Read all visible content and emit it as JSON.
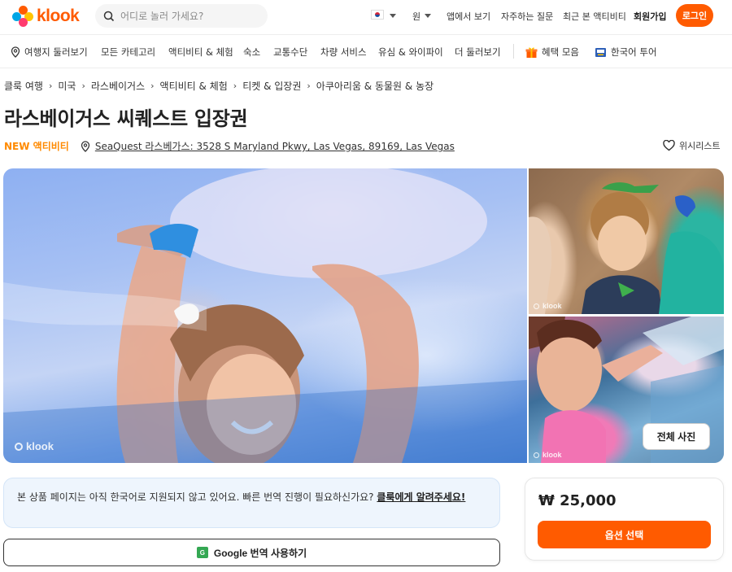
{
  "header": {
    "logo_text": "klook",
    "search_placeholder": "어디로 놀러 가세요?",
    "currency": "원",
    "links": {
      "app": "앱에서 보기",
      "faq": "자주하는 질문",
      "recent": "최근 본 액티비티",
      "signup": "회원가입",
      "login": "로그인"
    }
  },
  "nav": {
    "items": [
      "여행지 둘러보기",
      "모든 카테고리",
      "액티비티 & 체험",
      "숙소",
      "교통수단",
      "차량 서비스",
      "유심 & 와이파이",
      "더 둘러보기"
    ],
    "benefits": "혜택 모음",
    "korean_tour": "한국어 투어"
  },
  "breadcrumb": [
    "클룩 여행",
    "미국",
    "라스베이거스",
    "액티비티 & 체험",
    "티켓 & 입장권",
    "아쿠아리움 & 동물원 & 농장"
  ],
  "product": {
    "title": "라스베이거스 씨퀘스트 입장권",
    "badge": "NEW 액티비티",
    "address": "SeaQuest 라스베가스: 3528 S Maryland Pkwy, Las Vegas, 89169, Las Vegas",
    "wishlist": "위시리스트"
  },
  "gallery": {
    "watermark": "klook",
    "all_photos": "전체 사진"
  },
  "notice": {
    "text": "본 상품 페이지는 아직 한국어로 지원되지 않고 있어요. 빠른 번역 진행이 필요하신가요? ",
    "link": "클룩에게 알려주세요!"
  },
  "translate_button": "Google 번역 사용하기",
  "price_card": {
    "price": "₩ 25,000",
    "select_button": "옵션 선택"
  },
  "colors": {
    "brand": "#ff5b00",
    "new_badge": "#ff8a00",
    "notice_bg": "#eef5fd"
  }
}
